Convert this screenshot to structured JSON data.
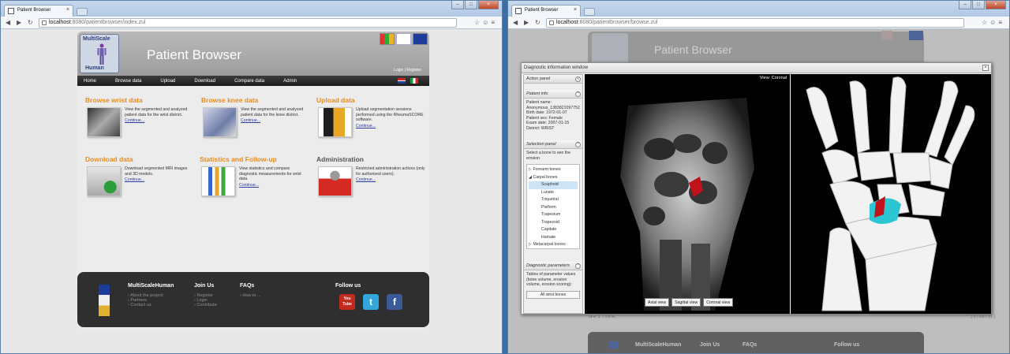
{
  "left": {
    "tab_title": "Patient Browser",
    "url_host": "localhost",
    "url_path": ":8080/patientbrowser/index.zul",
    "logo_top": "MultiScale",
    "logo_bottom": "Human",
    "site_title": "Patient Browser",
    "login": "Login",
    "separator": "|",
    "register": "Register",
    "menu": [
      "Home",
      "Browse data",
      "Upload",
      "Download",
      "Compare data",
      "Admin"
    ],
    "sections": [
      {
        "title": "Browse wrist data",
        "desc": "View the segmented and analyzed patient data for the wrist district.",
        "link": "Continue..."
      },
      {
        "title": "Browse knee data",
        "desc": "View the segmented and analyzed patient data for the knee district.",
        "link": "Continue..."
      },
      {
        "title": "Upload data",
        "desc": "Upload segmentation sessions performed using the RheumaSCORE software.",
        "link": "Continue..."
      },
      {
        "title": "Download data",
        "desc": "Download segmented MRI images and 3D models.",
        "link": "Continue..."
      },
      {
        "title": "Statistics and Follow-up",
        "desc": "View statistics and compare diagnostic measurements for wrist data.",
        "link": "Continue..."
      },
      {
        "title": "Administration",
        "desc": "Restricted administration actions (only for authorized users).",
        "link": "Continue..."
      }
    ],
    "footer": {
      "col1_title": "MultiScaleHuman",
      "col1_items": [
        "About the project",
        "Partners",
        "Contact us"
      ],
      "col2_title": "Join Us",
      "col2_items": [
        "Register",
        "Login",
        "Contribute"
      ],
      "col3_title": "FAQs",
      "col3_items": [
        "How to ..."
      ],
      "col4_title": "Follow us",
      "youtube_label": "You Tube"
    }
  },
  "right": {
    "tab_title": "Patient Browser",
    "url_host": "localhost",
    "url_path": ":8080/patientbrowser/browse.zul",
    "site_title": "Patient Browser",
    "dialog_title": "Diagnostic information window",
    "action_panel": "Action panel",
    "patient_info_title": "Patient info",
    "patient_info": [
      "Patient name:",
      "Anonymous_1383821097752",
      "Birth date: 1972-01-07",
      "Patient sex: Female",
      "Exam date: 2007-01-15",
      "District: WRIST"
    ],
    "selection_title": "Selection panel",
    "selection_hint": "Select a bone to see the erosion",
    "tree": [
      {
        "label": "Forearm bones",
        "toggle": "▷"
      },
      {
        "label": "Carpal bones",
        "toggle": "◢"
      },
      {
        "label": "Scaphoid",
        "sel": true
      },
      {
        "label": "Lunate"
      },
      {
        "label": "Triquetral"
      },
      {
        "label": "Pisiform"
      },
      {
        "label": "Trapezium"
      },
      {
        "label": "Trapezoid"
      },
      {
        "label": "Capitate"
      },
      {
        "label": "Hamate"
      },
      {
        "label": "Metacarpal bones",
        "toggle": "▷"
      }
    ],
    "diag_title": "Diagnostic parameters",
    "diag_text": "Tables of parameter values (bone volume, erosion volume, erosion scoring):",
    "all_wrist_btn": "All wrist bones",
    "view_label": "View: Coronal",
    "view_buttons": [
      "Axial view",
      "Sagittal view",
      "Coronal view"
    ],
    "pager_page": "1",
    "pager_of": "/ 3",
    "pager_right": "[ 1 / 16 / 31 ]",
    "footer": [
      "MultiScaleHuman",
      "Join Us",
      "FAQs",
      "Follow us"
    ]
  },
  "colors": {
    "accent_orange": "#e98c1f",
    "link_blue": "#2d3ca0",
    "footer_bg": "#2f2f2f",
    "erosion_red": "#c0121a",
    "erosion_cyan": "#2bc6d2"
  }
}
